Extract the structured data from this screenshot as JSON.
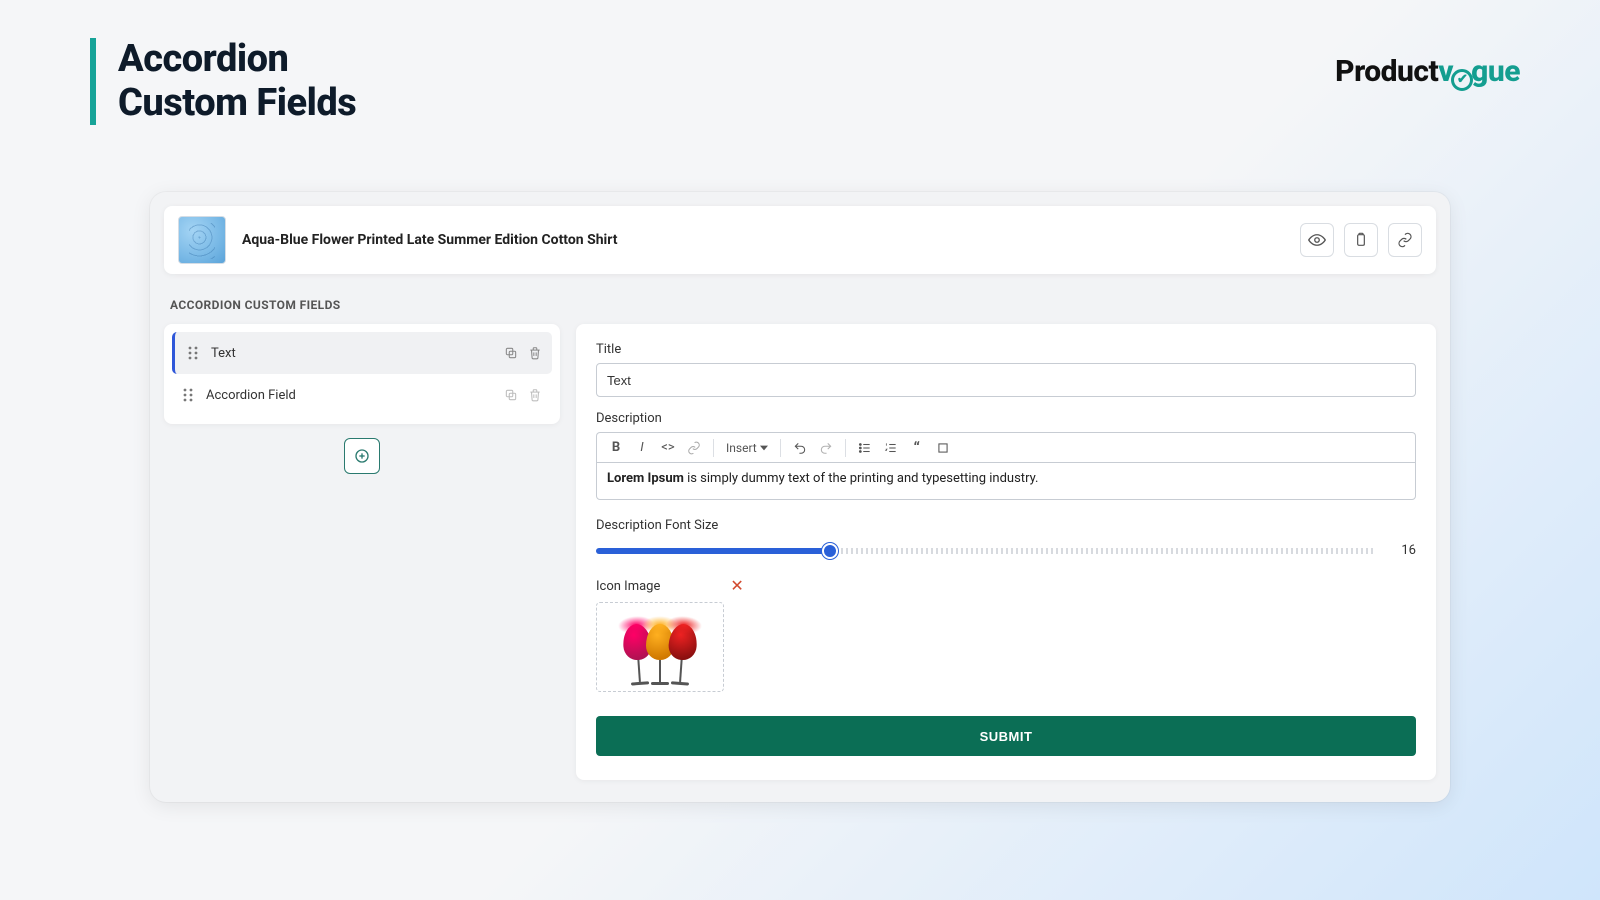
{
  "page_title_line1": "Accordion",
  "page_title_line2": "Custom Fields",
  "brand": {
    "part1": "Product",
    "part2_prefix": "v",
    "part2_suffix": "gue"
  },
  "product": {
    "title": "Aqua-Blue Flower Printed Late Summer Edition Cotton Shirt"
  },
  "section_label": "ACCORDION CUSTOM FIELDS",
  "sidebar": {
    "items": [
      {
        "label": "Text",
        "active": true
      },
      {
        "label": "Accordion Field",
        "active": false
      }
    ]
  },
  "editor": {
    "title_label": "Title",
    "title_value": "Text",
    "description_label": "Description",
    "insert_label": "Insert",
    "description_bold": "Lorem Ipsum",
    "description_rest": " is simply dummy text of the printing and typesetting industry.",
    "fontsize_label": "Description Font Size",
    "fontsize_value": "16",
    "icon_image_label": "Icon Image",
    "submit_label": "SUBMIT"
  }
}
